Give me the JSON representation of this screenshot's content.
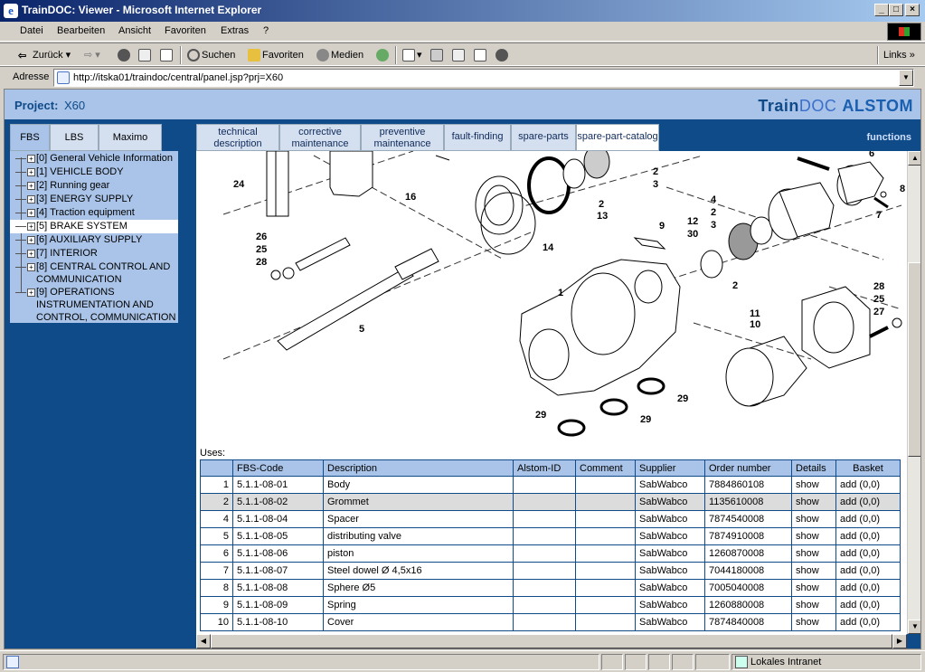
{
  "window": {
    "title": "TrainDOC: Viewer - Microsoft Internet Explorer"
  },
  "menu": [
    "Datei",
    "Bearbeiten",
    "Ansicht",
    "Favoriten",
    "Extras",
    "?"
  ],
  "toolbar": {
    "back": "Zurück",
    "search": "Suchen",
    "favorites": "Favoriten",
    "media": "Medien",
    "links": "Links"
  },
  "address": {
    "label": "Adresse",
    "url": "http://itska01/traindoc/central/panel.jsp?prj=X60"
  },
  "project": {
    "label": "Project:",
    "value": "X60"
  },
  "logo": {
    "train": "Train",
    "doc": "DOC",
    "company": "ALSTOM"
  },
  "left_tabs": [
    "FBS",
    "LBS",
    "Maximo"
  ],
  "tree": [
    "[0] General Vehicle Information",
    "[1] VEHICLE BODY",
    "[2] Running gear",
    "[3] ENERGY SUPPLY",
    "[4] Traction equipment",
    "[5] BRAKE SYSTEM",
    "[6] AUXILIARY SUPPLY",
    "[7] INTERIOR",
    "[8] CENTRAL CONTROL AND COMMUNICATION",
    "[9] OPERATIONS INSTRUMENTATION AND CONTROL, COMMUNICATION"
  ],
  "top_tabs": [
    "technical description",
    "corrective maintenance",
    "preventive maintenance",
    "fault-finding",
    "spare-parts",
    "spare-part-catalog"
  ],
  "functions_label": "functions",
  "drawing_labels": [
    "24",
    "16",
    "2",
    "13",
    "14",
    "3",
    "2",
    "26",
    "25",
    "28",
    "5",
    "1",
    "12",
    "30",
    "9",
    "4",
    "2",
    "3",
    "6",
    "8",
    "7",
    "2",
    "11",
    "10",
    "28",
    "25",
    "27",
    "29",
    "29",
    "29"
  ],
  "uses_label": "Uses:",
  "table": {
    "headers": [
      "",
      "FBS-Code",
      "Description",
      "Alstom-ID",
      "Comment",
      "Supplier",
      "Order number",
      "Details",
      "Basket"
    ],
    "rows": [
      [
        "1",
        "5.1.1-08-01",
        "Body",
        "",
        "",
        "SabWabco",
        "7884860108",
        "show",
        "add (0,0)"
      ],
      [
        "2",
        "5.1.1-08-02",
        "Grommet",
        "",
        "",
        "SabWabco",
        "1135610008",
        "show",
        "add (0,0)"
      ],
      [
        "4",
        "5.1.1-08-04",
        "Spacer",
        "",
        "",
        "SabWabco",
        "7874540008",
        "show",
        "add (0,0)"
      ],
      [
        "5",
        "5.1.1-08-05",
        "distributing valve",
        "",
        "",
        "SabWabco",
        "7874910008",
        "show",
        "add (0,0)"
      ],
      [
        "6",
        "5.1.1-08-06",
        "piston",
        "",
        "",
        "SabWabco",
        "1260870008",
        "show",
        "add (0,0)"
      ],
      [
        "7",
        "5.1.1-08-07",
        "Steel dowel Ø 4,5x16",
        "",
        "",
        "SabWabco",
        "7044180008",
        "show",
        "add (0,0)"
      ],
      [
        "8",
        "5.1.1-08-08",
        "Sphere Ø5",
        "",
        "",
        "SabWabco",
        "7005040008",
        "show",
        "add (0,0)"
      ],
      [
        "9",
        "5.1.1-08-09",
        "Spring",
        "",
        "",
        "SabWabco",
        "1260880008",
        "show",
        "add (0,0)"
      ],
      [
        "10",
        "5.1.1-08-10",
        "Cover",
        "",
        "",
        "SabWabco",
        "7874840008",
        "show",
        "add (0,0)"
      ]
    ]
  },
  "status": {
    "zone": "Lokales Intranet"
  }
}
